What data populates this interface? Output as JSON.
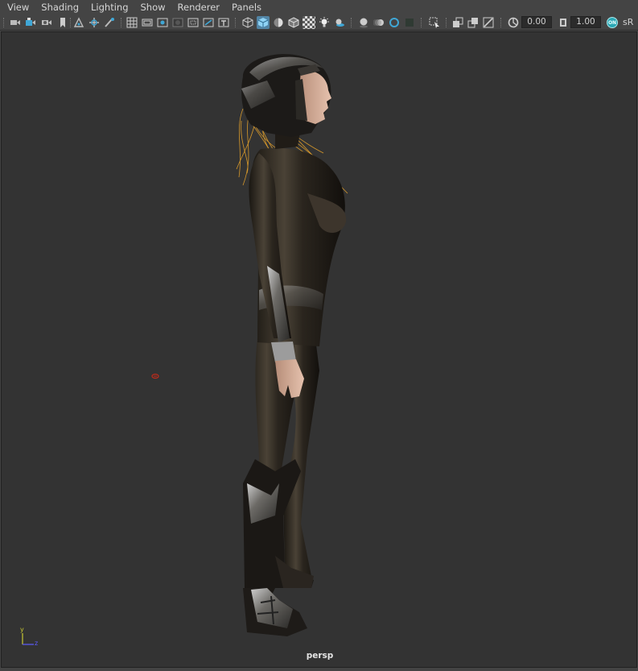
{
  "menubar": {
    "items": [
      "View",
      "Shading",
      "Lighting",
      "Show",
      "Renderer",
      "Panels"
    ]
  },
  "toolbar": {
    "exposure_value": "0.00",
    "gamma_value": "1.00",
    "color_mgmt_badge": "ON",
    "color_space_label": "sR",
    "icons": [
      "camera-icon",
      "camera-attributes-icon",
      "snapshot-icon",
      "bookmark-icon",
      "image-plane-icon",
      "move-camera-icon",
      "paint-tool-icon",
      "grid-icon",
      "film-gate-icon",
      "resolution-gate-icon",
      "gate-mask-icon",
      "field-chart-icon",
      "safe-action-icon",
      "safe-title-icon",
      "wireframe-icon",
      "smooth-shade-icon",
      "default-material-icon",
      "wireframe-on-shaded-icon",
      "xray-icon",
      "use-all-lights-icon",
      "shadows-icon",
      "screen-space-ao-icon",
      "motion-blur-icon",
      "multisample-aa-icon",
      "depth-of-field-icon",
      "isolate-select-icon",
      "xray-joints-icon",
      "xray-active-icon",
      "backface-icon",
      "exposure-icon",
      "gamma-icon"
    ]
  },
  "viewport": {
    "camera_label": "persp",
    "background_color": "#333333",
    "axis": {
      "y_label": "y",
      "z_label": "z",
      "y_color": "#c8c832",
      "z_color": "#5c5cff"
    }
  },
  "colors": {
    "accent": "#5285a6",
    "hair": "#e8a32a",
    "locator": "#c02a1a"
  }
}
